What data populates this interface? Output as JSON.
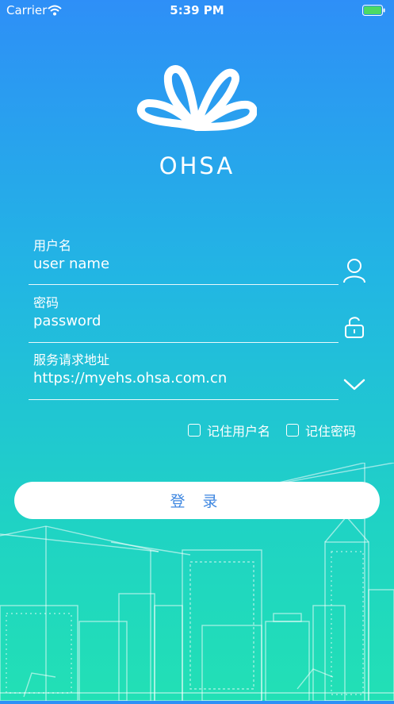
{
  "status_bar": {
    "carrier": "Carrier",
    "time": "5:39 PM"
  },
  "brand": {
    "name": "OHSA"
  },
  "form": {
    "username_label": "用户名",
    "username_placeholder": "user name",
    "password_label": "密码",
    "password_placeholder": "password",
    "server_label": "服务请求地址",
    "server_value": "https://myehs.ohsa.com.cn",
    "remember_username": "记住用户名",
    "remember_password": "记住密码",
    "login_button": "登 录"
  },
  "icons": {
    "username": "user-icon",
    "password": "unlock-icon",
    "server": "chevron-down-icon"
  },
  "colors": {
    "gradient_top": "#2e8ff7",
    "gradient_bottom": "#22e0b5",
    "button_text": "#3d86e0",
    "battery": "#4cd964"
  }
}
